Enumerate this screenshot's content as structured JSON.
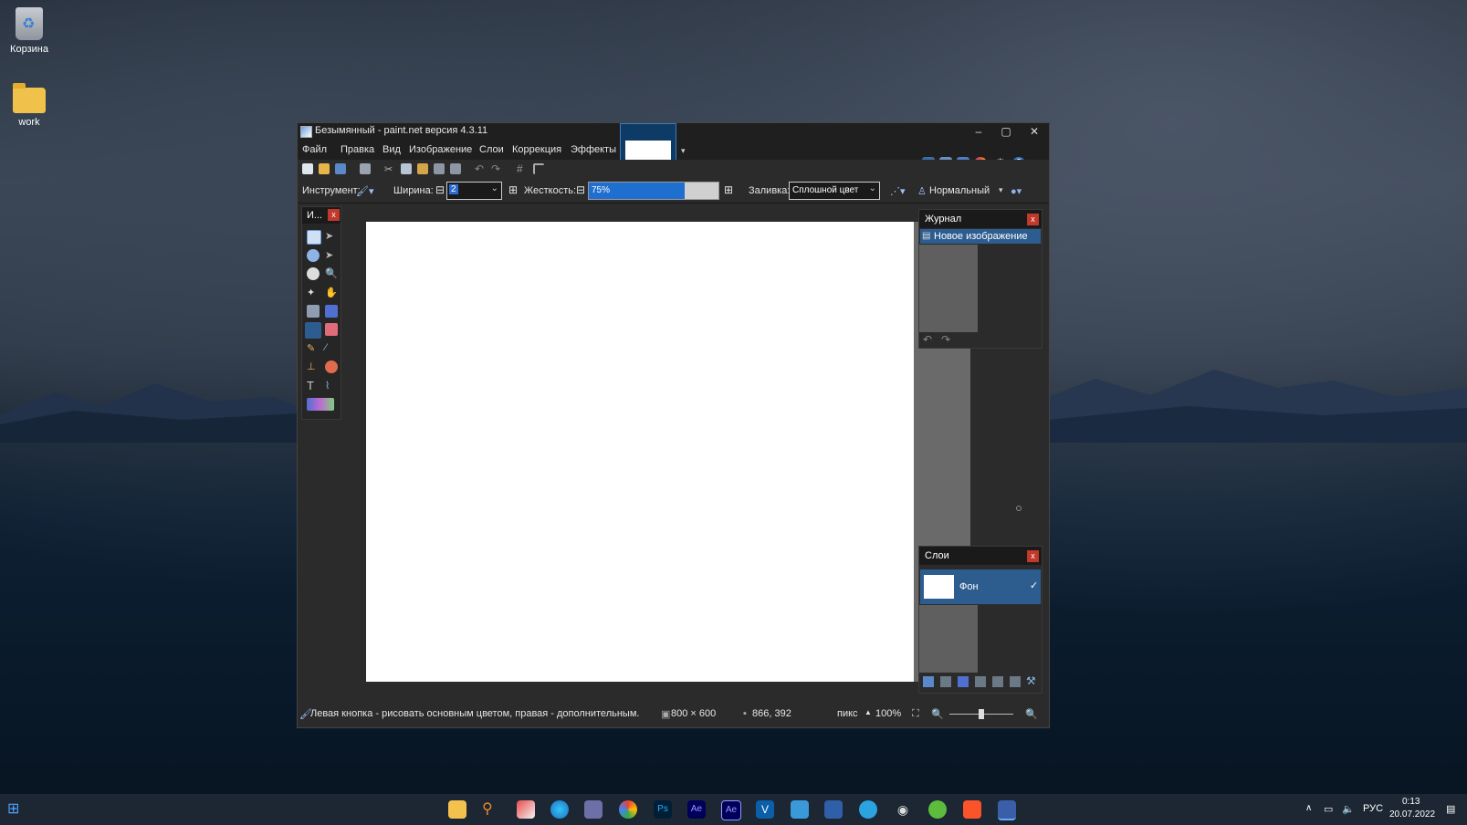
{
  "desktop": {
    "icons": [
      {
        "label": "Корзина"
      },
      {
        "label": "work"
      }
    ]
  },
  "window": {
    "title": "Безымянный - paint.net версия 4.3.11",
    "menu": [
      "Файл",
      "Правка",
      "Вид",
      "Изображение",
      "Слои",
      "Коррекция",
      "Эффекты"
    ],
    "options": {
      "tool_label": "Инструмент:",
      "width_label": "Ширина:",
      "width_value": "2",
      "hardness_label": "Жесткость:",
      "hardness_value": "75%",
      "fill_label": "Заливка:",
      "fill_value": "Сплошной цвет",
      "blend_value": "Нормальный"
    },
    "tools_panel_title": "И...",
    "history": {
      "title": "Журнал",
      "items": [
        "Новое изображение"
      ]
    },
    "layers": {
      "title": "Слои",
      "items": [
        "Фон"
      ]
    },
    "status": {
      "hint": "Левая кнопка - рисовать основным цветом, правая - дополнительным.",
      "size": "800 × 600",
      "cursor": "866, 392",
      "units": "пикс",
      "zoom": "100%"
    }
  },
  "tray": {
    "lang": "РУС",
    "time": "0:13",
    "date": "20.07.2022"
  }
}
